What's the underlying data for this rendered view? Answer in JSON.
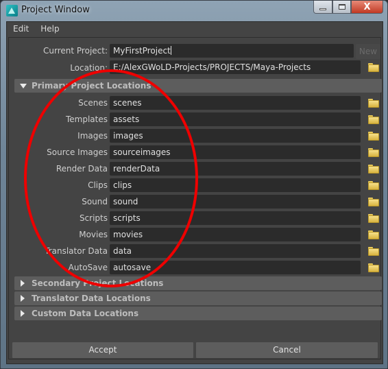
{
  "window": {
    "title": "Project Window",
    "controls": {
      "minimize": "minimize",
      "maximize": "maximize",
      "close": "X"
    }
  },
  "menu": [
    "Edit",
    "Help"
  ],
  "current_project": {
    "label": "Current Project:",
    "value": "MyFirstProject"
  },
  "new_button": "New",
  "location": {
    "label": "Location:",
    "value": "E:/AlexGWoLD-Projects/PROJECTS/Maya-Projects"
  },
  "sections": {
    "primary": {
      "label": "Primary Project Locations",
      "expanded": true
    },
    "secondary": {
      "label": "Secondary Project Locations",
      "expanded": false
    },
    "translator": {
      "label": "Translator Data Locations",
      "expanded": false
    },
    "custom": {
      "label": "Custom Data Locations",
      "expanded": false
    }
  },
  "primary_locations": [
    {
      "label": "Scenes",
      "value": "scenes"
    },
    {
      "label": "Templates",
      "value": "assets"
    },
    {
      "label": "Images",
      "value": "images"
    },
    {
      "label": "Source Images",
      "value": "sourceimages"
    },
    {
      "label": "Render Data",
      "value": "renderData"
    },
    {
      "label": "Clips",
      "value": "clips"
    },
    {
      "label": "Sound",
      "value": "sound"
    },
    {
      "label": "Scripts",
      "value": "scripts"
    },
    {
      "label": "Movies",
      "value": "movies"
    },
    {
      "label": "Translator Data",
      "value": "data"
    },
    {
      "label": "AutoSave",
      "value": "autosave"
    }
  ],
  "buttons": {
    "accept": "Accept",
    "cancel": "Cancel"
  },
  "colors": {
    "annotation": "#ee0000",
    "folder": "#e8c95a",
    "close": "#c13a24"
  }
}
